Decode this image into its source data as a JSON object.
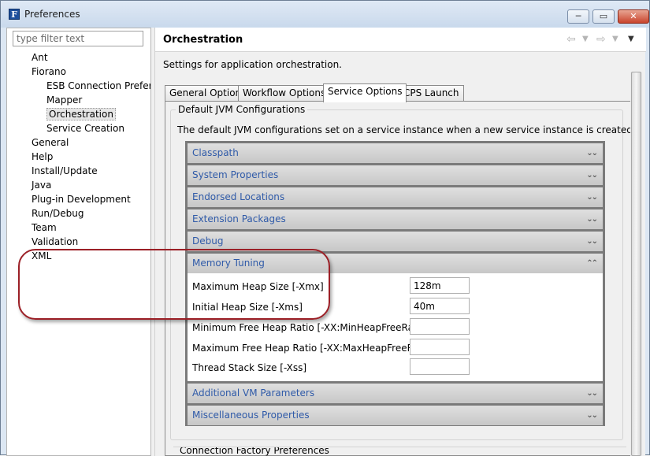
{
  "window": {
    "title": "Preferences",
    "app_icon_letter": "F",
    "minimize_glyph": "─",
    "maximize_glyph": "▭",
    "close_glyph": "✕"
  },
  "filter": {
    "placeholder": "type filter text",
    "value": ""
  },
  "tree": [
    {
      "label": "Ant",
      "level": 0
    },
    {
      "label": "Fiorano",
      "level": 0
    },
    {
      "label": "ESB Connection Preferences",
      "level": 1
    },
    {
      "label": "Mapper",
      "level": 1
    },
    {
      "label": "Orchestration",
      "level": 1,
      "selected": true
    },
    {
      "label": "Service Creation",
      "level": 1
    },
    {
      "label": "General",
      "level": 0
    },
    {
      "label": "Help",
      "level": 0
    },
    {
      "label": "Install/Update",
      "level": 0
    },
    {
      "label": "Java",
      "level": 0
    },
    {
      "label": "Plug-in Development",
      "level": 0
    },
    {
      "label": "Run/Debug",
      "level": 0
    },
    {
      "label": "Team",
      "level": 0
    },
    {
      "label": "Validation",
      "level": 0
    },
    {
      "label": "XML",
      "level": 0
    }
  ],
  "page": {
    "title": "Orchestration",
    "description": "Settings for application orchestration.",
    "nav": {
      "back_icon": "arrow-left-icon",
      "forward_icon": "arrow-right-icon",
      "menu_icon": "chevron-down-icon"
    }
  },
  "tabs": [
    {
      "label": "General Options"
    },
    {
      "label": "Workflow Options"
    },
    {
      "label": "Service Options",
      "active": true
    },
    {
      "label": "CPS Launch"
    }
  ],
  "group": {
    "title": "Default JVM Configurations",
    "description": "The default JVM configurations set on a service instance when a new service instance is created."
  },
  "sections": {
    "classpath": "Classpath",
    "system_properties": "System Properties",
    "endorsed_locations": "Endorsed Locations",
    "extension_packages": "Extension Packages",
    "debug": "Debug",
    "memory_tuning": "Memory Tuning",
    "additional_vm_parameters": "Additional VM Parameters",
    "miscellaneous_properties": "Miscellaneous Properties",
    "collapsed_chevron": "⌄⌄",
    "expanded_chevron": "⌃⌃"
  },
  "memory": {
    "max_heap_label": "Maximum Heap Size [-Xmx]",
    "max_heap_value": "128m",
    "initial_heap_label": "Initial Heap Size [-Xms]",
    "initial_heap_value": "40m",
    "min_free_label": "Minimum Free Heap Ratio [-XX:MinHeapFreeRatio]",
    "min_free_value": "",
    "max_free_label": "Maximum Free Heap Ratio [-XX:MaxHeapFreeRatio]",
    "max_free_value": "",
    "thread_stack_label": "Thread Stack Size [-Xss]",
    "thread_stack_value": ""
  },
  "next_group": {
    "title": "Connection Factory Preferences"
  },
  "colors": {
    "highlight": "#9b1f26",
    "section_text": "#2f5aa8"
  }
}
